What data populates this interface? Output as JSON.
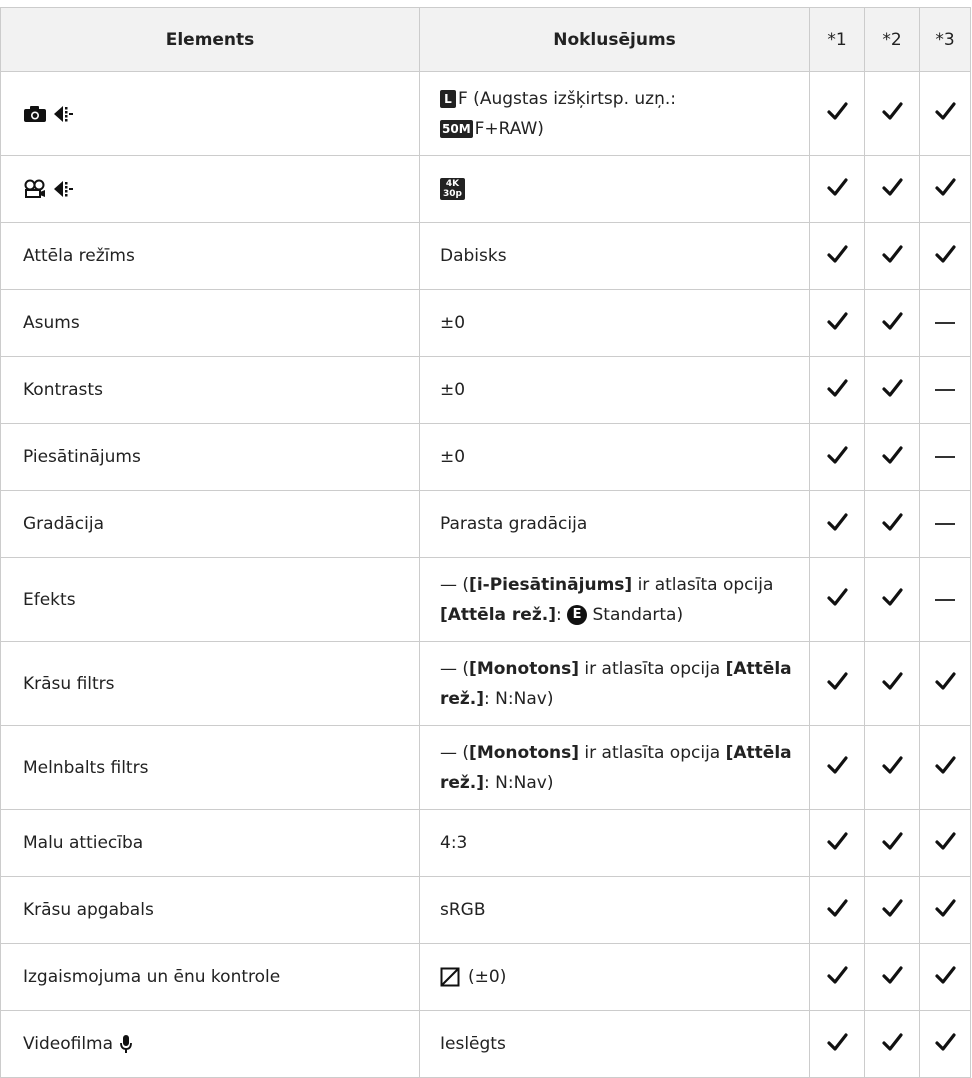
{
  "headers": {
    "element": "Elements",
    "default": "Noklusējums",
    "col1": "*1",
    "col2": "*2",
    "col3": "*3"
  },
  "rows": [
    {
      "element": "",
      "icons": [
        "camera-icon",
        "quality-icon"
      ],
      "default_pre": "F (Augstas izšķirtsp. uzņ.:",
      "default_post": "F+RAW)",
      "marks": [
        "check",
        "check",
        "check"
      ]
    },
    {
      "element": "",
      "icons": [
        "movie-icon",
        "quality-icon"
      ],
      "default": "",
      "marks": [
        "check",
        "check",
        "check"
      ]
    },
    {
      "element": "Attēla režīms",
      "default": "Dabisks",
      "marks": [
        "check",
        "check",
        "check"
      ]
    },
    {
      "element": "Asums",
      "default": "±0",
      "marks": [
        "check",
        "check",
        "dash"
      ]
    },
    {
      "element": "Kontrasts",
      "default": "±0",
      "marks": [
        "check",
        "check",
        "dash"
      ]
    },
    {
      "element": "Piesātinājums",
      "default": "±0",
      "marks": [
        "check",
        "check",
        "dash"
      ]
    },
    {
      "element": "Gradācija",
      "default": "Parasta gradācija",
      "marks": [
        "check",
        "check",
        "dash"
      ]
    },
    {
      "element": "Efekts",
      "default_a": "— (",
      "default_bold1": "[i-Piesātinājums]",
      "default_b": " ir atlasīta opcija ",
      "default_bold2": "[Attēla rež.]",
      "default_c": ": ",
      "default_d": " Standarta)",
      "marks": [
        "check",
        "check",
        "dash"
      ]
    },
    {
      "element": "Krāsu filtrs",
      "default_a": "— (",
      "default_bold1": "[Monotons]",
      "default_b": " ir atlasīta opcija ",
      "default_bold2": "[Attēla rež.]",
      "default_c": ": N:Nav)",
      "marks": [
        "check",
        "check",
        "check"
      ]
    },
    {
      "element": "Melnbalts filtrs",
      "default_a": "— (",
      "default_bold1": "[Monotons]",
      "default_b": " ir atlasīta opcija ",
      "default_bold2": "[Attēla rež.]",
      "default_c": ": N:Nav)",
      "marks": [
        "check",
        "check",
        "check"
      ]
    },
    {
      "element": "Malu attiecība",
      "default": "4:3",
      "marks": [
        "check",
        "check",
        "check"
      ]
    },
    {
      "element": "Krāsu apgabals",
      "default": "sRGB",
      "marks": [
        "check",
        "check",
        "check"
      ]
    },
    {
      "element": "Izgaismojuma un ēnu kontrole",
      "default": "(±0)",
      "marks": [
        "check",
        "check",
        "check"
      ]
    },
    {
      "element": "Videofilma",
      "default": "Ieslēgts",
      "marks": [
        "check",
        "check",
        "check"
      ]
    }
  ],
  "badges": {
    "l": "L",
    "m50": "50M",
    "k4": "4K",
    "p30": "30p",
    "e": "E"
  }
}
